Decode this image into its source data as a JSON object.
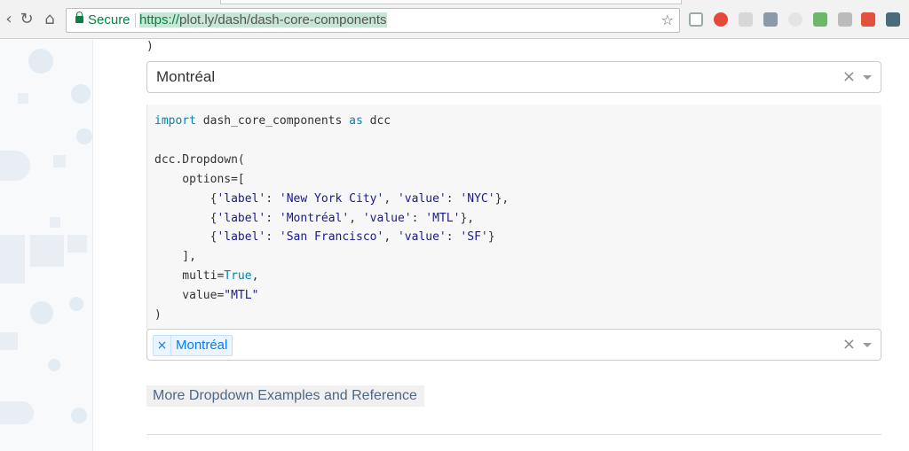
{
  "browser": {
    "back_icon": "back-arrow-icon",
    "reload_icon": "reload-icon",
    "home_icon": "home-icon",
    "secure_label": "Secure",
    "url_scheme": "https://",
    "url_host": "plot.ly",
    "url_path": "/dash/dash-core-components"
  },
  "top_snippet": {
    "closing_paren": ")"
  },
  "dropdown_single": {
    "value": "Montréal",
    "clear_glyph": "×"
  },
  "code": {
    "lines": [
      [
        {
          "t": "import",
          "c": "kw"
        },
        {
          "t": " dash_core_components "
        },
        {
          "t": "as",
          "c": "kw"
        },
        {
          "t": " dcc"
        }
      ],
      [
        {
          "t": ""
        }
      ],
      [
        {
          "t": "dcc.Dropdown("
        }
      ],
      [
        {
          "t": "    options=["
        }
      ],
      [
        {
          "t": "        {"
        },
        {
          "t": "'label'",
          "c": "str"
        },
        {
          "t": ": "
        },
        {
          "t": "'New York City'",
          "c": "str"
        },
        {
          "t": ", "
        },
        {
          "t": "'value'",
          "c": "str"
        },
        {
          "t": ": "
        },
        {
          "t": "'NYC'",
          "c": "str"
        },
        {
          "t": "},"
        }
      ],
      [
        {
          "t": "        {"
        },
        {
          "t": "'label'",
          "c": "str"
        },
        {
          "t": ": "
        },
        {
          "t": "'Montréal'",
          "c": "str"
        },
        {
          "t": ", "
        },
        {
          "t": "'value'",
          "c": "str"
        },
        {
          "t": ": "
        },
        {
          "t": "'MTL'",
          "c": "str"
        },
        {
          "t": "},"
        }
      ],
      [
        {
          "t": "        {"
        },
        {
          "t": "'label'",
          "c": "str"
        },
        {
          "t": ": "
        },
        {
          "t": "'San Francisco'",
          "c": "str"
        },
        {
          "t": ", "
        },
        {
          "t": "'value'",
          "c": "str"
        },
        {
          "t": ": "
        },
        {
          "t": "'SF'",
          "c": "str"
        },
        {
          "t": "}"
        }
      ],
      [
        {
          "t": "    ],"
        }
      ],
      [
        {
          "t": "    multi="
        },
        {
          "t": "True",
          "c": "builtin"
        },
        {
          "t": ","
        }
      ],
      [
        {
          "t": "    value="
        },
        {
          "t": "\"MTL\"",
          "c": "str"
        }
      ],
      [
        {
          "t": ")"
        }
      ]
    ]
  },
  "dropdown_multi": {
    "chip_label": "Montréal",
    "chip_remove": "×",
    "clear_glyph": "×"
  },
  "more_link": "More Dropdown Examples and Reference",
  "colors": {
    "secure_green": "#0b8043",
    "link_blue": "#007eff",
    "chip_bg": "#ebf5ff"
  }
}
